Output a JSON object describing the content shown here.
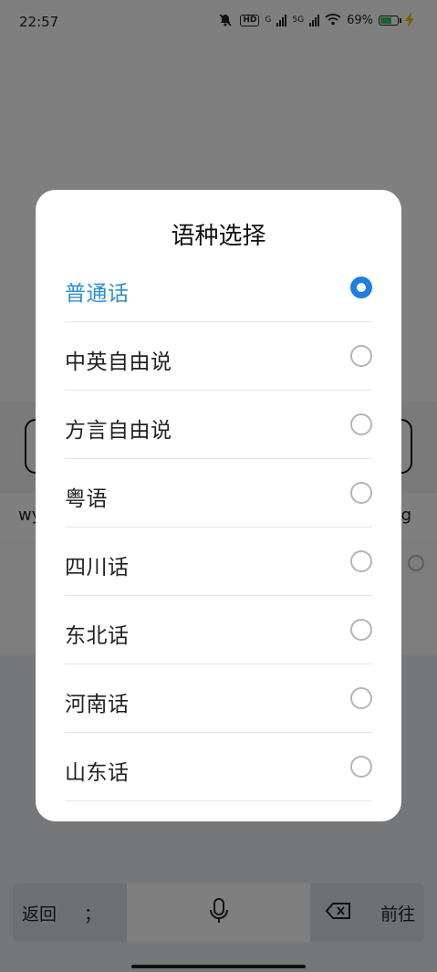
{
  "status_bar": {
    "time": "22:57",
    "network_badge": "HD",
    "net_g": "G",
    "net_5g": "5G",
    "battery_text": "69%",
    "battery_level": 0.69,
    "colors": {
      "battery": "#35c759",
      "charging": "#f5c400"
    }
  },
  "background": {
    "suggest_left": "wy",
    "suggest_right": "g"
  },
  "keyboard": {
    "back_label": "返回",
    "semicolon": "；",
    "forward_label": "前往"
  },
  "dialog": {
    "title": "语种选择",
    "options": [
      {
        "label": "普通话",
        "selected": true
      },
      {
        "label": "中英自由说",
        "selected": false
      },
      {
        "label": "方言自由说",
        "selected": false
      },
      {
        "label": "粤语",
        "selected": false
      },
      {
        "label": "四川话",
        "selected": false
      },
      {
        "label": "东北话",
        "selected": false
      },
      {
        "label": "河南话",
        "selected": false
      },
      {
        "label": "山东话",
        "selected": false
      }
    ],
    "colors": {
      "selected_text": "#2f8fcf",
      "radio_selected": "#1e7fe0"
    }
  }
}
